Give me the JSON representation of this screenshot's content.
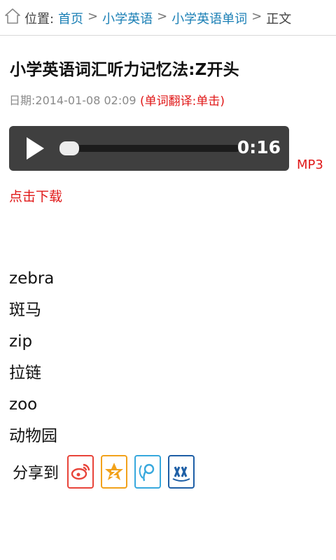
{
  "breadcrumb": {
    "label": "位置:",
    "items": [
      "首页",
      "小学英语",
      "小学英语单词"
    ],
    "current": "正文",
    "separator": ">"
  },
  "article": {
    "title": "小学英语词汇听力记忆法:Z开头",
    "date": "日期:2014-01-08 02:09",
    "hint": "(单词翻译:单击)"
  },
  "player": {
    "time": "0:16",
    "progress": 0.0,
    "format_label": "MP3"
  },
  "download_label": "点击下载",
  "words": [
    {
      "en": "zebra",
      "zh": "斑马"
    },
    {
      "en": "zip",
      "zh": "拉链"
    },
    {
      "en": "zoo",
      "zh": "动物园"
    }
  ],
  "share": {
    "label": "分享到",
    "targets": [
      {
        "icon": "weibo-icon",
        "color": "#e8443a"
      },
      {
        "icon": "qzone-icon",
        "color": "#f2a21b"
      },
      {
        "icon": "tencent-weibo-icon",
        "color": "#37a8dd"
      },
      {
        "icon": "renren-icon",
        "color": "#1e5fa6"
      }
    ]
  }
}
